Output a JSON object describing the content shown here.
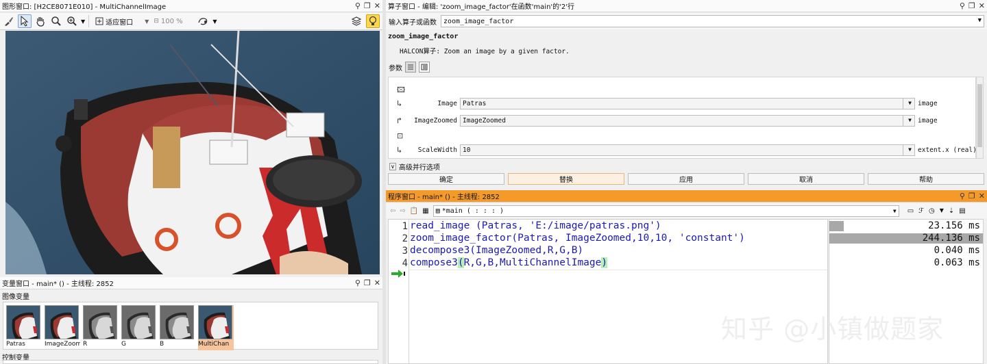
{
  "graphics_window": {
    "title": "图形窗口: [H2CE8071E010] - MultiChannelImage",
    "fit_label": "适应窗口",
    "zoom_value": "100 %"
  },
  "variable_window": {
    "title": "变量窗口 - main* () - 主线程: 2852",
    "iconic_label": "图像变量",
    "control_label": "控制变量",
    "thumbnails": [
      {
        "name": "Patras",
        "kind": "color"
      },
      {
        "name": "ImageZoom",
        "kind": "color"
      },
      {
        "name": "R",
        "kind": "gray"
      },
      {
        "name": "G",
        "kind": "gray"
      },
      {
        "name": "B",
        "kind": "gray"
      },
      {
        "name": "MultiChan",
        "kind": "color",
        "selected": true
      }
    ]
  },
  "operator_window": {
    "title": "算子窗口 - 编辑: 'zoom_image_factor'在函数'main'的'2'行",
    "input_label": "输入算子或函数",
    "input_value": "zoom_image_factor",
    "op_name": "zoom_image_factor",
    "op_desc": "HALCON算子: Zoom an image by a given factor.",
    "params_label": "参数",
    "params": [
      {
        "name": "Image",
        "value": "Patras",
        "type": "image"
      },
      {
        "name": "ImageZoomed",
        "value": "ImageZoomed",
        "type": "image"
      },
      {
        "name": "ScaleWidth",
        "value": "10",
        "type": "extent.x (real)"
      }
    ],
    "parallel_label": "高级并行选项",
    "buttons": {
      "ok": "确定",
      "replace": "替换",
      "apply": "应用",
      "cancel": "取消",
      "help": "帮助"
    }
  },
  "program_window": {
    "title": "程序窗口 - main* () - 主线程: 2852",
    "proc_value": "*main ( : : : )",
    "line_numbers": [
      "1",
      "2",
      "3",
      "4"
    ],
    "lines": [
      "read_image (Patras, 'E:/image/patras.png')",
      "zoom_image_factor(Patras, ImageZoomed,10,10, 'constant')",
      "decompose3(ImageZoomed,R,G,B)"
    ],
    "line4": {
      "pre": "compose3",
      "open": "(",
      "args": "R,G,B,MultiChannelImage",
      "close": ")"
    },
    "timings": [
      {
        "text": "23.156 ms",
        "fraction": 0.095
      },
      {
        "text": "244.136 ms",
        "fraction": 1.0
      },
      {
        "text": "0.040 ms",
        "fraction": 0.0
      },
      {
        "text": "0.063 ms",
        "fraction": 0.0
      }
    ]
  },
  "watermark": "知乎 @小镇做题家",
  "colors": {
    "program_header": "#f39a2b",
    "selected_thumb": "#f7c49b",
    "code_text": "#1a1ab4",
    "timing_bar": "#a8a8a8"
  }
}
